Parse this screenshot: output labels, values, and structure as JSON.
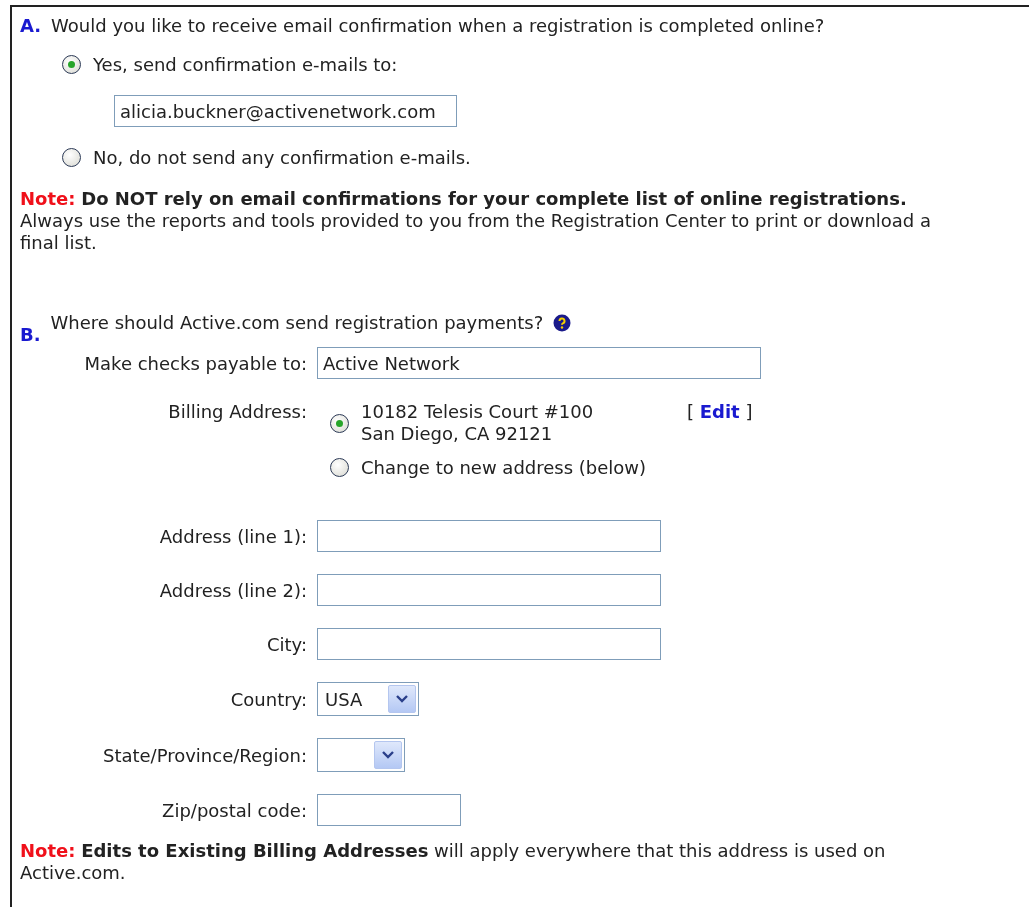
{
  "section_a": {
    "letter": "A.",
    "question": "Would you like to receive email confirmation when a registration is completed online?",
    "options": [
      {
        "label": "Yes, send confirmation e-mails to:",
        "selected": true
      },
      {
        "label": "No, do not send any confirmation e-mails.",
        "selected": false
      }
    ],
    "email": {
      "value": "alicia.buckner@activenetwork.com"
    },
    "note": {
      "label": "Note:",
      "text": "**Do NOT rely on email confirmations for your complete list of online registrations.**\nAlways use the reports and tools provided to you from the Registration Center to print or download a\nfinal list."
    }
  },
  "section_b": {
    "letter": "B.",
    "question": "Where should Active.com send registration payments?",
    "payable": {
      "label": "Make checks payable to:",
      "value": "Active Network"
    },
    "billing": {
      "label": "Billing Address:",
      "edit_link": "[ **Edit** ]",
      "options": [
        {
          "label": "10182 Telesis Court #100\nSan Diego, CA 92121",
          "selected": true
        },
        {
          "label": "Change to new address (below)",
          "selected": false
        }
      ]
    },
    "fields": [
      {
        "kind": "text",
        "label": "Address (line 1):"
      },
      {
        "kind": "text",
        "label": "Address (line 2):"
      },
      {
        "kind": "text",
        "label": "City:"
      },
      {
        "kind": "select",
        "label": "Country:",
        "value": "USA"
      },
      {
        "kind": "select",
        "label": "State/Province/Region:"
      },
      {
        "kind": "short_text",
        "label": "Zip/postal code:"
      }
    ],
    "note": {
      "label": "Note:",
      "text": "**Edits to Existing Billing Addresses** will apply everywhere that this address is used on\nActive.com."
    }
  }
}
